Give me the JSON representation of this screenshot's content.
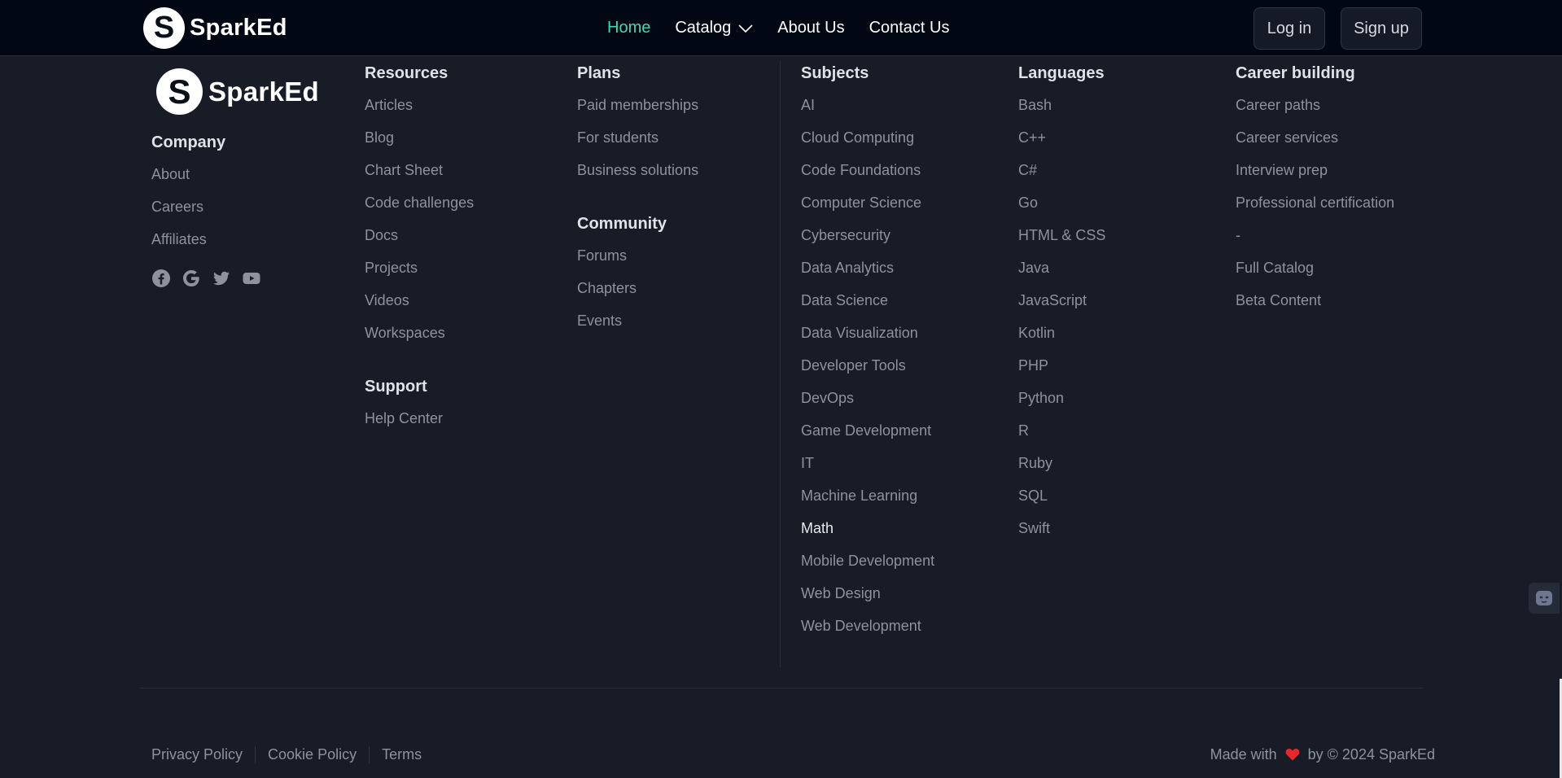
{
  "brand": {
    "badge_letter": "S",
    "name": "SparkEd"
  },
  "nav": {
    "links": [
      {
        "label": "Home"
      },
      {
        "label": "Catalog"
      },
      {
        "label": "About Us"
      },
      {
        "label": "Contact Us"
      }
    ],
    "active": "Home",
    "login_label": "Log in",
    "signup_label": "Sign up"
  },
  "footer": {
    "company": {
      "title": "Company",
      "links": [
        "About",
        "Careers",
        "Affiliates"
      ],
      "social": [
        "facebook-icon",
        "google-icon",
        "twitter-icon",
        "youtube-icon"
      ]
    },
    "resources": {
      "title": "Resources",
      "links": [
        "Articles",
        "Blog",
        "Chart Sheet",
        "Code challenges",
        "Docs",
        "Projects",
        "Videos",
        "Workspaces"
      ]
    },
    "support": {
      "title": "Support",
      "links": [
        "Help Center"
      ]
    },
    "plans": {
      "title": "Plans",
      "links": [
        "Paid memberships",
        "For students",
        "Business solutions"
      ]
    },
    "community": {
      "title": "Community",
      "links": [
        "Forums",
        "Chapters",
        "Events"
      ]
    },
    "subjects": {
      "title": "Subjects",
      "links": [
        "AI",
        "Cloud Computing",
        "Code Foundations",
        "Computer Science",
        "Cybersecurity",
        "Data Analytics",
        "Data Science",
        "Data Visualization",
        "Developer Tools",
        "DevOps",
        "Game Development",
        "IT",
        "Machine Learning",
        "Math",
        "Mobile Development",
        "Web Design",
        "Web Development"
      ],
      "highlighted": "Math"
    },
    "languages": {
      "title": "Languages",
      "links": [
        "Bash",
        "C++",
        "C#",
        "Go",
        "HTML & CSS",
        "Java",
        "JavaScript",
        "Kotlin",
        "PHP",
        "Python",
        "R",
        "Ruby",
        "SQL",
        "Swift"
      ]
    },
    "career": {
      "title": "Career building",
      "links": [
        "Career paths",
        "Career services",
        "Interview prep",
        "Professional certification",
        "-",
        "Full Catalog",
        "Beta Content"
      ]
    },
    "legal": [
      "Privacy Policy",
      "Cookie Policy",
      "Terms"
    ],
    "made_with_prefix": "Made with",
    "made_with_suffix": "by © 2024 SparkEd"
  },
  "colors": {
    "background": "#171c27",
    "nav_background": "#020813",
    "accent": "#3fd9b1",
    "heart": "#e8262c"
  }
}
